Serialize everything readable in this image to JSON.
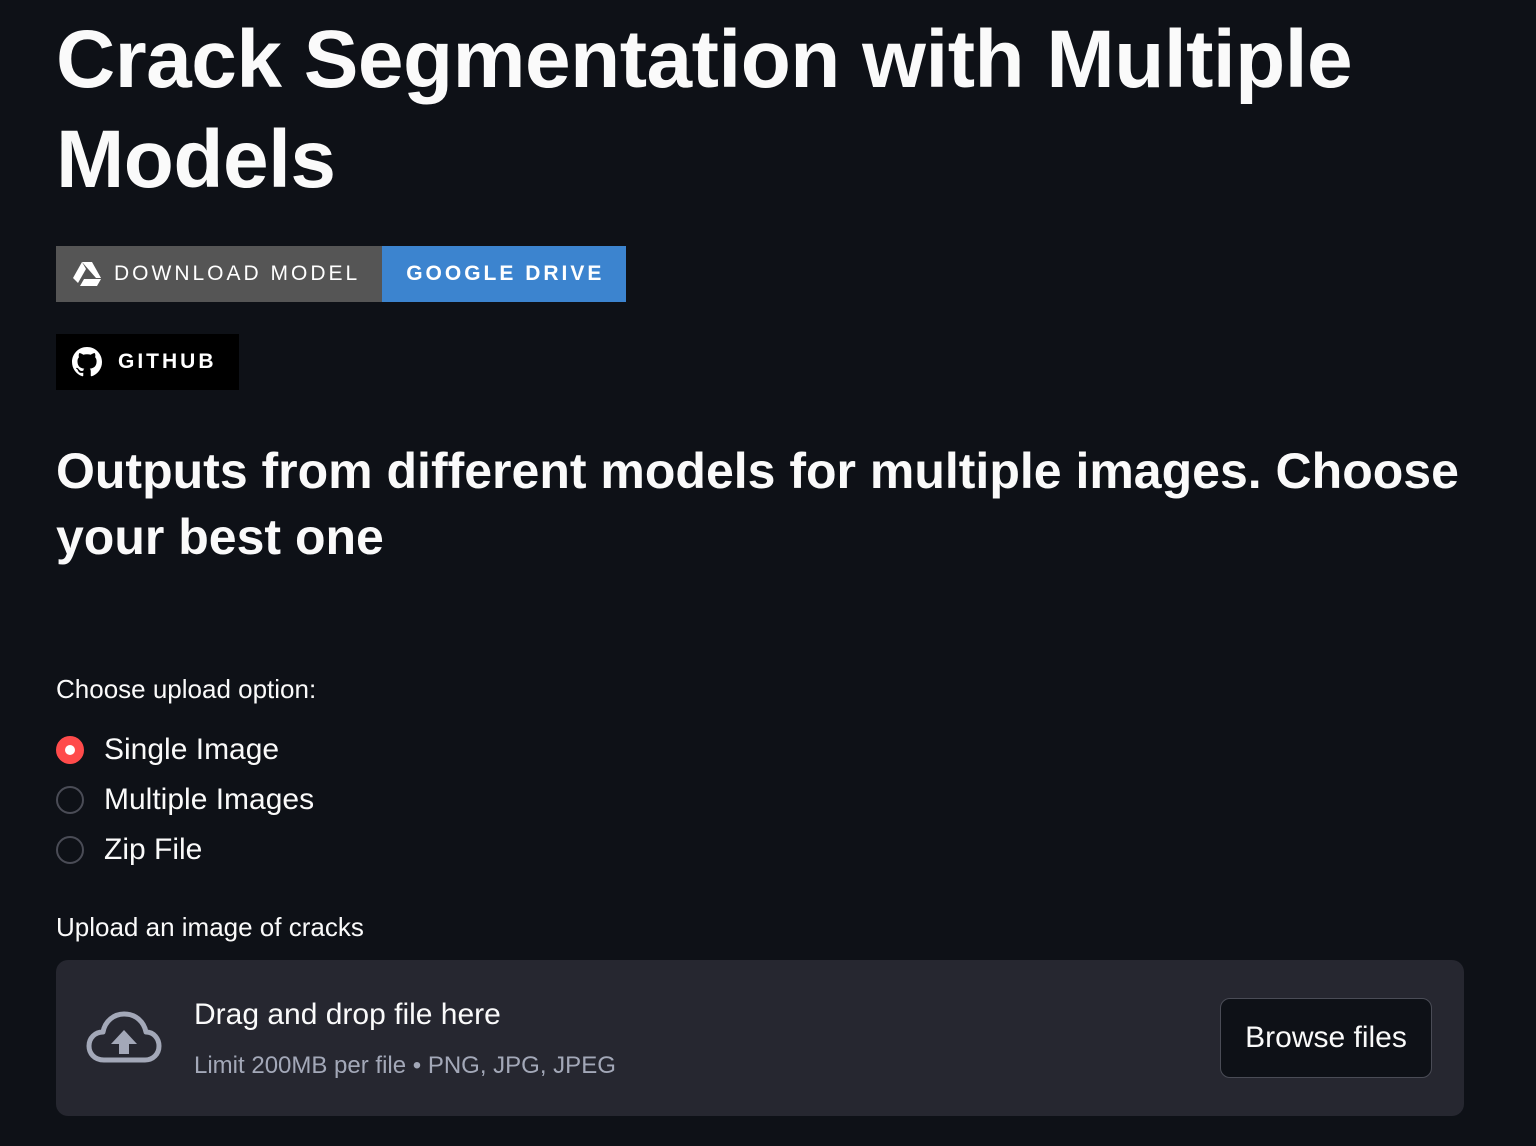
{
  "page": {
    "title": "Crack Segmentation with Multiple Models",
    "subtitle": "Outputs from different models for multiple images. Choose your best one"
  },
  "badges": {
    "download_label": "DOWNLOAD MODEL",
    "download_value": "GOOGLE DRIVE",
    "github_label": "GITHUB",
    "download_left_color": "#555555",
    "download_right_color": "#3c84cf",
    "github_color": "#000000",
    "download_icon": "google-drive-icon",
    "github_icon": "github-icon"
  },
  "upload_option": {
    "label": "Choose upload option:",
    "options": [
      "Single Image",
      "Multiple Images",
      "Zip File"
    ],
    "selected": "Single Image",
    "accent_color": "#ff4b4b"
  },
  "uploader": {
    "label": "Upload an image of cracks",
    "drop_title": "Drag and drop file here",
    "limit_text": "Limit 200MB per file • PNG, JPG, JPEG",
    "browse_label": "Browse files",
    "icon": "cloud-upload-icon"
  }
}
